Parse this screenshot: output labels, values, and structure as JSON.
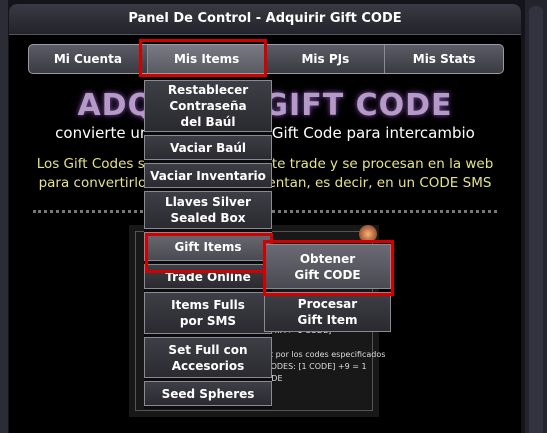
{
  "panel": {
    "title": "Panel De Control - Adquirir Gift CODE"
  },
  "tabs": [
    {
      "label": "Mi Cuenta"
    },
    {
      "label": "Mis Items"
    },
    {
      "label": "Mis PJs"
    },
    {
      "label": "Mis Stats"
    }
  ],
  "content": {
    "big_title": "ADQUIRIR GIFT CODE",
    "subtitle": "convierte un Gift Item en un Gift Code para intercambio",
    "description_line1": "Los Gift Codes se obtienen mediante trade y se procesan en la web",
    "description_line2": "para convertirlos en lo que representan, es decir, en un CODE SMS"
  },
  "screen_text": {
    "line1": "DATA > 1 CODE]",
    "line2": "et por los codes especificados",
    "line3": "CODES: [1 CODE] +9 = 1",
    "line4": "ODE"
  },
  "dropdown": [
    {
      "lines": [
        "Restablecer",
        "Contraseña",
        "del Baúl"
      ]
    },
    {
      "lines": [
        "Vaciar Baúl"
      ]
    },
    {
      "lines": [
        "Vaciar Inventario"
      ]
    },
    {
      "lines": [
        "Llaves Silver",
        "Sealed Box"
      ]
    },
    {
      "lines": [
        "Gift Items"
      ]
    },
    {
      "lines": [
        "Trade Online"
      ]
    },
    {
      "lines": [
        "Items Fulls",
        "por SMS"
      ]
    },
    {
      "lines": [
        "Set Full con",
        "Accesorios"
      ]
    },
    {
      "lines": [
        "Seed Spheres"
      ]
    }
  ],
  "submenu": [
    {
      "lines": [
        "Obtener",
        "Gift CODE"
      ]
    },
    {
      "lines": [
        "Procesar",
        "Gift Item"
      ]
    }
  ]
}
